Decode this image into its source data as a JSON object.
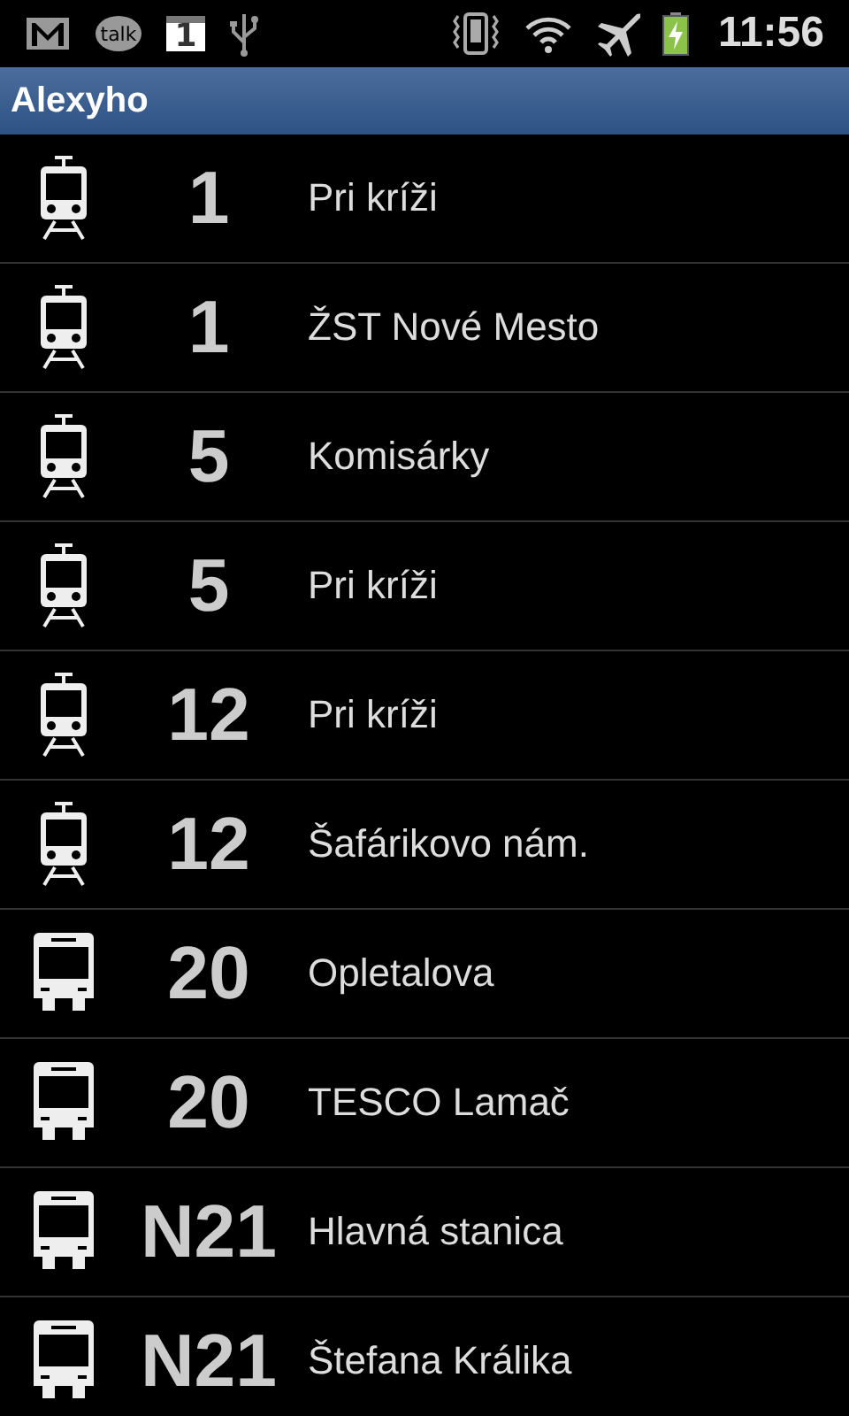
{
  "status_bar": {
    "notifications": [
      {
        "kind": "mail"
      },
      {
        "kind": "talk",
        "text": "talk"
      },
      {
        "kind": "calendar",
        "text": "1"
      },
      {
        "kind": "usb"
      }
    ],
    "indicators": [
      {
        "kind": "vibrate"
      },
      {
        "kind": "wifi"
      },
      {
        "kind": "airplane"
      },
      {
        "kind": "battery"
      }
    ],
    "time": "11:56"
  },
  "title": "Alexyho",
  "departures": [
    {
      "kind": "tram",
      "line": "1",
      "stop": "Pri kríži"
    },
    {
      "kind": "tram",
      "line": "1",
      "stop": "ŽST Nové Mesto"
    },
    {
      "kind": "tram",
      "line": "5",
      "stop": "Komisárky"
    },
    {
      "kind": "tram",
      "line": "5",
      "stop": "Pri kríži"
    },
    {
      "kind": "tram",
      "line": "12",
      "stop": "Pri kríži"
    },
    {
      "kind": "tram",
      "line": "12",
      "stop": "Šafárikovo nám."
    },
    {
      "kind": "bus",
      "line": "20",
      "stop": "Opletalova"
    },
    {
      "kind": "bus",
      "line": "20",
      "stop": "TESCO Lamač"
    },
    {
      "kind": "bus",
      "line": "N21",
      "stop": "Hlavná stanica"
    },
    {
      "kind": "bus",
      "line": "N21",
      "stop": "Štefana Králika"
    }
  ]
}
